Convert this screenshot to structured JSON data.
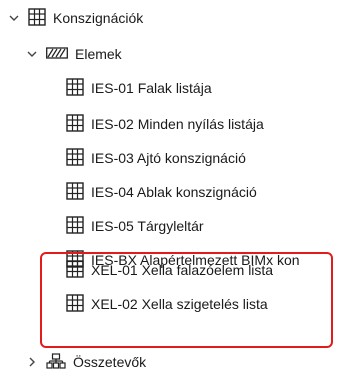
{
  "tree": {
    "root": {
      "label": "Konszignációk"
    },
    "group": {
      "label": "Elemek"
    },
    "items": [
      {
        "label": "IES-01 Falak listája"
      },
      {
        "label": "IES-02 Minden nyílás listája"
      },
      {
        "label": "IES-03 Ajtó konszignáció"
      },
      {
        "label": "IES-04 Ablak konszignáció"
      },
      {
        "label": "IES-05 Tárgyleltár"
      },
      {
        "label": "IES-BX Alapértelmezett BIMx kon"
      },
      {
        "label": "XEL-01 Xella falazóelem lista"
      },
      {
        "label": "XEL-02 Xella szigetelés lista"
      }
    ],
    "sibling": {
      "label": "Összetevők"
    }
  },
  "icons": {
    "table": "table-grid-icon",
    "hatch": "hatched-element-icon",
    "components": "component-tree-icon",
    "expanded": "chevron-down-icon",
    "collapsed": "chevron-right-icon"
  },
  "colors": {
    "highlight": "#e21b1b"
  }
}
